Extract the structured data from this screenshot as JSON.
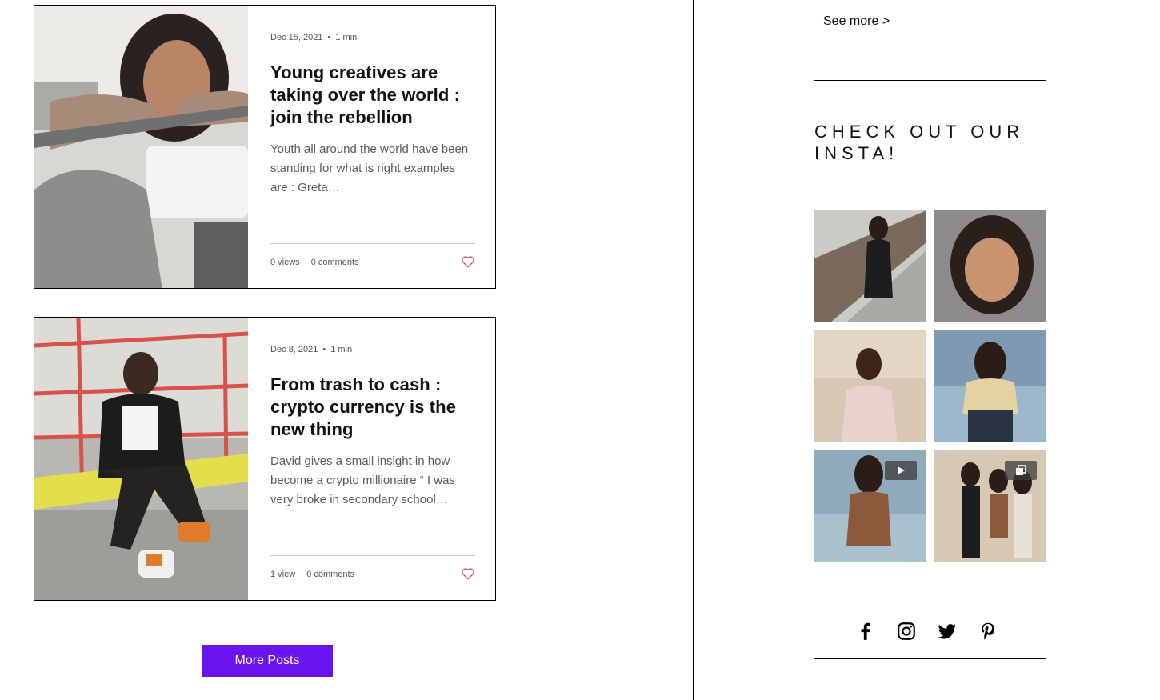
{
  "posts": [
    {
      "date": "Dec 15, 2021",
      "read_time": "1 min",
      "title": "Young creatives are taking over the world : join the rebellion",
      "excerpt": "Youth all around the world have been standing for what is right examples are : Greta…",
      "views": "0 views",
      "comments": "0 comments"
    },
    {
      "date": "Dec 8, 2021",
      "read_time": "1 min",
      "title": "From trash to cash : crypto currency is the new thing",
      "excerpt": "David gives a small insight in how become a crypto millionaire “ I was very broke in secondary school…",
      "views": "1 view",
      "comments": "0 comments"
    }
  ],
  "more_posts_label": "More Posts",
  "sidebar": {
    "see_more": "See more >",
    "insta_heading": "CHECK OUT OUR INSTA!",
    "insta_tiles": [
      {
        "badge": ""
      },
      {
        "badge": ""
      },
      {
        "badge": ""
      },
      {
        "badge": ""
      },
      {
        "badge": "video-icon"
      },
      {
        "badge": "gallery-icon"
      }
    ],
    "social_icons": [
      "facebook-icon",
      "instagram-icon",
      "twitter-icon",
      "pinterest-icon"
    ]
  },
  "colors": {
    "accent": "#6a12f0",
    "heart": "#e04a57",
    "divider": "#000000"
  }
}
